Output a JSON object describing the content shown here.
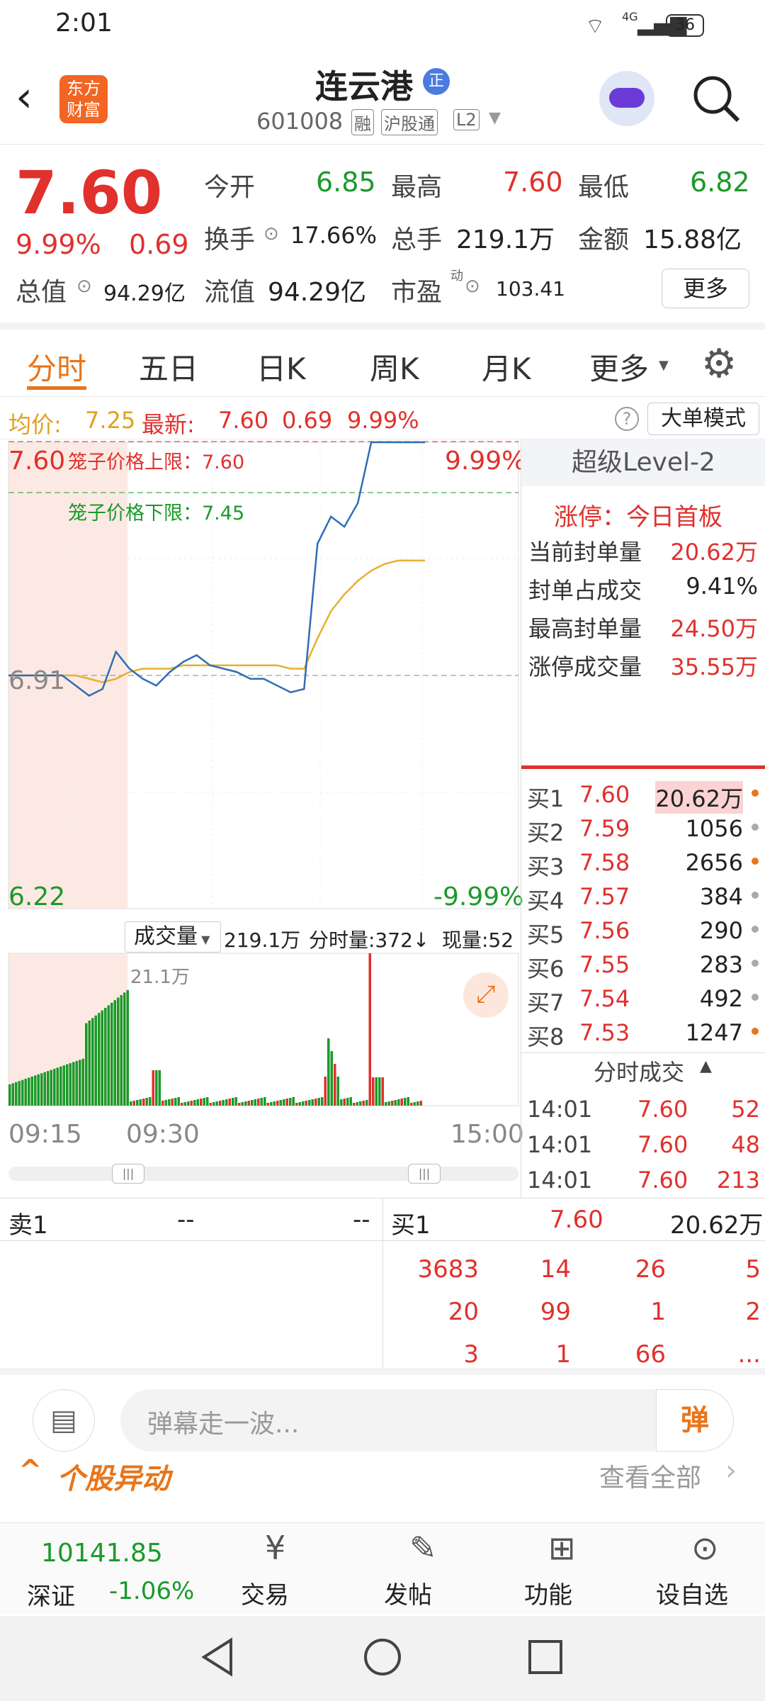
{
  "status": {
    "time": "2:01",
    "battery": "36",
    "net": "4G"
  },
  "header": {
    "title": "连云港",
    "title_badge": "正",
    "code": "601008",
    "badges": [
      "融",
      "沪股通",
      "L2"
    ],
    "logo_line1": "东方",
    "logo_line2": "财富"
  },
  "quote": {
    "price": "7.60",
    "pct": "9.99%",
    "chg": "0.69",
    "open_label": "今开",
    "open": "6.85",
    "high_label": "最高",
    "high": "7.60",
    "low_label": "最低",
    "low": "6.82",
    "turnover_label": "换手",
    "turnover": "17.66%",
    "volume_label": "总手",
    "volume": "219.1万",
    "amount_label": "金额",
    "amount": "15.88亿",
    "mcap_label": "总值",
    "mcap": "94.29亿",
    "float_label": "流值",
    "float": "94.29亿",
    "pe_label": "市盈",
    "pe_sup": "动",
    "pe": "103.41",
    "more": "更多"
  },
  "tabs": [
    "分时",
    "五日",
    "日K",
    "周K",
    "月K",
    "更多"
  ],
  "infobar": {
    "avg_label": "均价:",
    "avg": "7.25",
    "last_label": "最新:",
    "last": "7.60",
    "chg": "0.69",
    "pct": "9.99%",
    "big_order": "大单模式"
  },
  "chart": {
    "y_top": "7.60",
    "y_mid": "6.91",
    "y_bottom": "6.22",
    "pct_top": "9.99%",
    "pct_bottom": "-9.99%",
    "cage_upper": "笼子价格上限：7.60",
    "cage_lower": "笼子价格下限：7.45",
    "vol_label": "成交量",
    "vol_total": "219.1万",
    "vol_min": "分时量:372↓",
    "vol_now": "现量:52",
    "vol_scale": "21.1万",
    "t_start": "09:15",
    "t_open": "09:30",
    "t_end": "15:00"
  },
  "chart_data": {
    "type": "line",
    "title": "",
    "xlabel": "",
    "ylabel": "",
    "ylim": [
      6.22,
      7.6
    ],
    "series": [
      {
        "name": "最新",
        "values": [
          6.91,
          6.91,
          6.91,
          6.91,
          6.91,
          6.88,
          6.85,
          6.87,
          6.98,
          6.93,
          6.9,
          6.88,
          6.92,
          6.95,
          6.97,
          6.94,
          6.93,
          6.92,
          6.9,
          6.9,
          6.88,
          6.86,
          6.87,
          7.3,
          7.38,
          7.35,
          7.42,
          7.6,
          7.6,
          7.6,
          7.6,
          7.6
        ]
      },
      {
        "name": "均价",
        "values": [
          6.91,
          6.91,
          6.91,
          6.91,
          6.91,
          6.91,
          6.9,
          6.89,
          6.9,
          6.92,
          6.93,
          6.93,
          6.93,
          6.94,
          6.94,
          6.94,
          6.94,
          6.94,
          6.94,
          6.94,
          6.94,
          6.93,
          6.93,
          7.02,
          7.1,
          7.15,
          7.19,
          7.22,
          7.24,
          7.25,
          7.25,
          7.25
        ]
      }
    ]
  },
  "level2": {
    "title": "超级Level-2",
    "limit_label": "涨停：今日首板",
    "rows": [
      {
        "k": "当前封单量",
        "v": "20.62万"
      },
      {
        "k": "封单占成交",
        "v": "9.41%"
      },
      {
        "k": "最高封单量",
        "v": "24.50万"
      },
      {
        "k": "涨停成交量",
        "v": "35.55万"
      }
    ],
    "bids": [
      {
        "k": "买1",
        "p": "7.60",
        "v": "20.62万"
      },
      {
        "k": "买2",
        "p": "7.59",
        "v": "1056"
      },
      {
        "k": "买3",
        "p": "7.58",
        "v": "2656"
      },
      {
        "k": "买4",
        "p": "7.57",
        "v": "384"
      },
      {
        "k": "买5",
        "p": "7.56",
        "v": "290"
      },
      {
        "k": "买6",
        "p": "7.55",
        "v": "283"
      },
      {
        "k": "买7",
        "p": "7.54",
        "v": "492"
      },
      {
        "k": "买8",
        "p": "7.53",
        "v": "1247"
      }
    ],
    "ticks_label": "分时成交",
    "ticks": [
      {
        "t": "14:01",
        "p": "7.60",
        "v": "52"
      },
      {
        "t": "14:01",
        "p": "7.60",
        "v": "48"
      },
      {
        "t": "14:01",
        "p": "7.60",
        "v": "213"
      }
    ]
  },
  "book": {
    "sell1": "卖1",
    "sell_p": "--",
    "sell_v": "--",
    "buy1": "买1",
    "buy_p": "7.60",
    "buy_v": "20.62万",
    "queue": [
      [
        "3683",
        "14",
        "26",
        "5"
      ],
      [
        "20",
        "99",
        "1",
        "2"
      ],
      [
        "3",
        "1",
        "66",
        "..."
      ]
    ]
  },
  "comment": {
    "placeholder": "弹幕走一波...",
    "danmu": "弹"
  },
  "alert": {
    "title": "个股异动",
    "view_all": "查看全部"
  },
  "index": {
    "value": "10141.85",
    "name": "深证",
    "pct": "-1.06%"
  },
  "nav": [
    "交易",
    "发帖",
    "功能",
    "设自选"
  ]
}
